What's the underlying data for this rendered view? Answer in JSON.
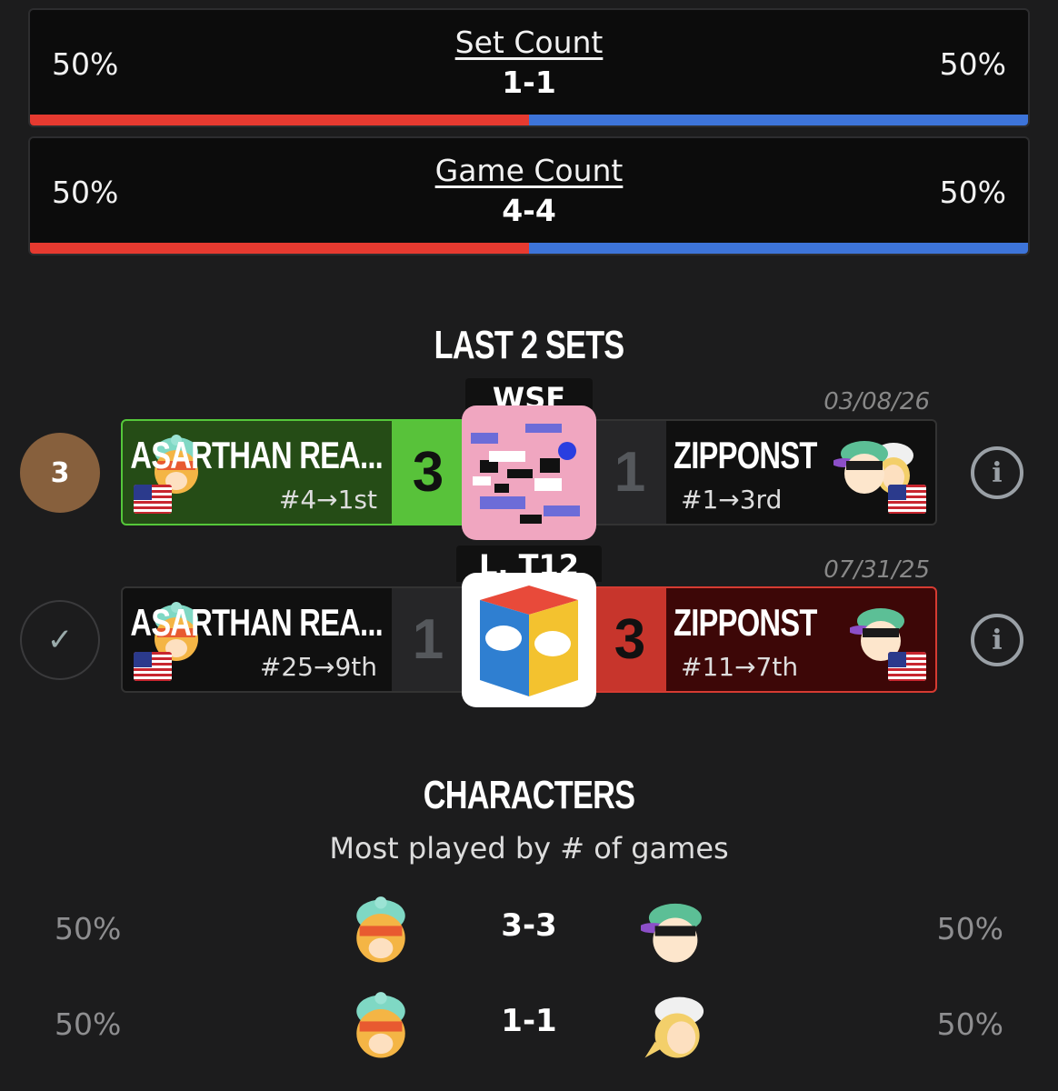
{
  "set_count": {
    "title": "Set Count",
    "score": "1-1",
    "left_pct": "50%",
    "right_pct": "50%",
    "left_share": 0.5
  },
  "game_count": {
    "title": "Game Count",
    "score": "4-4",
    "left_pct": "50%",
    "right_pct": "50%",
    "left_share": 0.5
  },
  "colors": {
    "red": "#e63a30",
    "blue": "#3d74d9",
    "win_green": "#58c23a",
    "win_red": "#c7352c",
    "gold_badge": "#87603d"
  },
  "last_sets": {
    "title": "LAST 2 SETS",
    "sets": [
      {
        "badge": "3",
        "event": "WSF",
        "date": "03/08/26",
        "left": {
          "name": "ASARTHAN REA...",
          "seed": "#4→1st",
          "score": "3",
          "result": "win"
        },
        "right": {
          "name": "ZIPPONST",
          "seed": "#1→3rd",
          "score": "1",
          "result": "loss"
        },
        "info_icon": "info-icon"
      },
      {
        "badge": "✓",
        "event": "L. T12",
        "date": "07/31/25",
        "left": {
          "name": "ASARTHAN REA...",
          "seed": "#25→9th",
          "score": "1",
          "result": "loss"
        },
        "right": {
          "name": "ZIPPONST",
          "seed": "#11→7th",
          "score": "3",
          "result": "win"
        },
        "info_icon": "info-icon"
      }
    ]
  },
  "characters": {
    "title": "CHARACTERS",
    "subtitle": "Most played by # of games",
    "rows": [
      {
        "left_pct": "50%",
        "score": "3-3",
        "right_pct": "50%",
        "left_icon": "orange-hair-beanie-character-icon",
        "right_icon": "green-cap-character-icon"
      },
      {
        "left_pct": "50%",
        "score": "1-1",
        "right_pct": "50%",
        "left_icon": "orange-hair-beanie-character-icon",
        "right_icon": "white-cap-blonde-character-icon"
      }
    ]
  }
}
